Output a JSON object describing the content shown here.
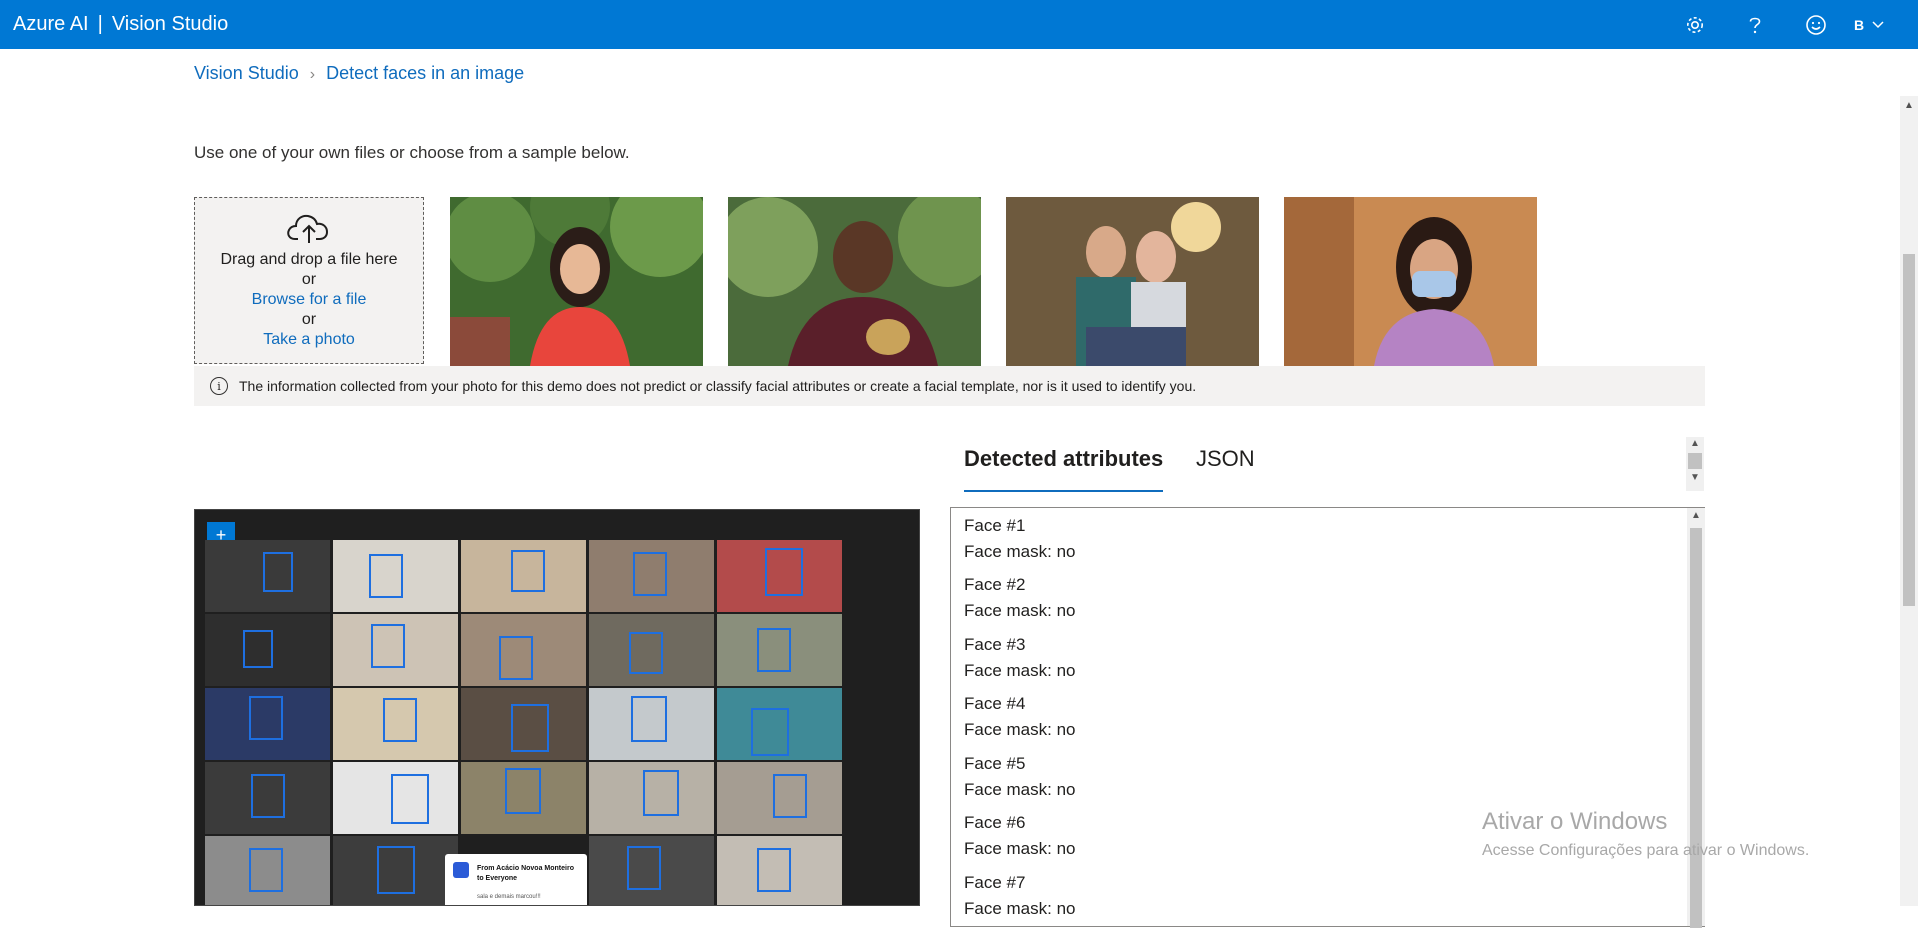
{
  "header": {
    "brand": "Azure AI",
    "separator": "|",
    "product": "Vision Studio",
    "avatar_initial": "B",
    "icons": [
      "gear-icon",
      "help-icon",
      "smiley-icon",
      "chevron-down-icon"
    ]
  },
  "breadcrumb": {
    "root": "Vision Studio",
    "current": "Detect faces in an image"
  },
  "instruction": "Use one of your own files or choose from a sample below.",
  "upload": {
    "line1": "Drag and drop a file here",
    "or1": "or",
    "browse": "Browse for a file",
    "or2": "or",
    "photo": "Take a photo"
  },
  "notice": "The information collected from your photo for this demo does not predict or classify facial attributes or create a facial template, nor is it used to identify you.",
  "tabs": {
    "detected": "Detected attributes",
    "json": "JSON"
  },
  "faces": [
    {
      "title": "Face #1",
      "mask": "Face mask: no"
    },
    {
      "title": "Face #2",
      "mask": "Face mask: no"
    },
    {
      "title": "Face #3",
      "mask": "Face mask: no"
    },
    {
      "title": "Face #4",
      "mask": "Face mask: no"
    },
    {
      "title": "Face #5",
      "mask": "Face mask: no"
    },
    {
      "title": "Face #6",
      "mask": "Face mask: no"
    },
    {
      "title": "Face #7",
      "mask": "Face mask: no"
    }
  ],
  "toast": {
    "title": "From Acácio Novoa Monteiro to Everyone",
    "body": "sala e demais marcou!!!"
  },
  "watermark": {
    "line1": "Ativar o Windows",
    "line2": "Acesse Configurações para ativar o Windows."
  },
  "colors": {
    "topbar": "#0078d4",
    "link": "#0f6cbd",
    "face_box": "#1e6fe0"
  }
}
